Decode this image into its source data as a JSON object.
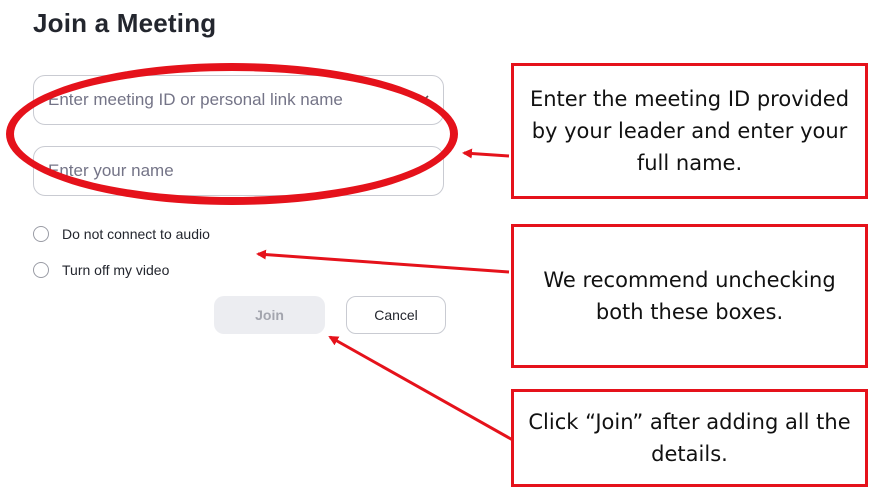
{
  "dialog": {
    "title": "Join a Meeting",
    "meeting_id_placeholder": "Enter meeting ID or personal link name",
    "name_placeholder": "Enter your name",
    "options": [
      {
        "label": "Do not connect to audio",
        "checked": false
      },
      {
        "label": "Turn off my video",
        "checked": false
      }
    ],
    "join_label": "Join",
    "cancel_label": "Cancel"
  },
  "annotations": {
    "callout_1": "Enter the meeting ID provided by your leader and enter your full name.",
    "callout_2": "We recommend unchecking both these boxes.",
    "callout_3": "Click “Join” after adding all the details.",
    "color": "#e5121b"
  }
}
